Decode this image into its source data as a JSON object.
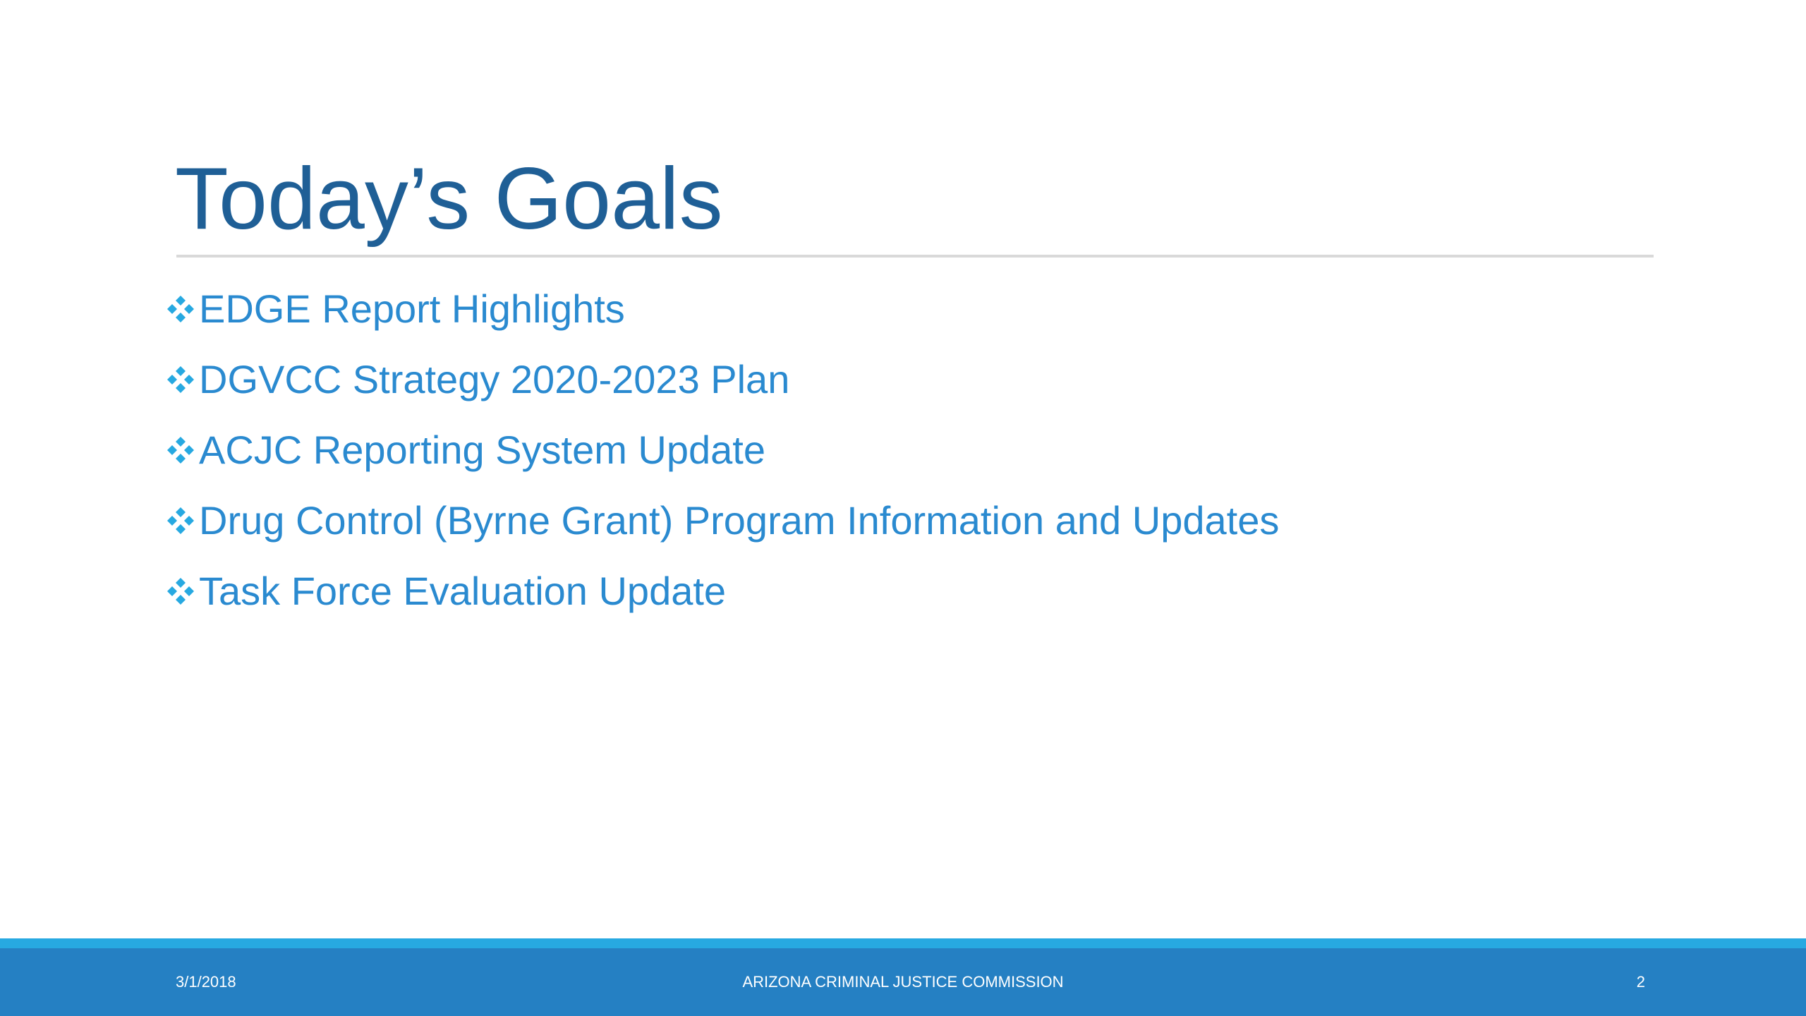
{
  "slide": {
    "title": "Today’s Goals",
    "bullets": [
      "EDGE Report Highlights",
      "DGVCC Strategy 2020-2023 Plan",
      "ACJC Reporting System Update",
      "Drug Control (Byrne Grant) Program Information and Updates",
      "Task Force Evaluation Update"
    ],
    "bullet_icon": "four-diamond-bullet-icon"
  },
  "footer": {
    "date": "3/1/2018",
    "organization": "ARIZONA CRIMINAL JUSTICE COMMISSION",
    "page_number": "2"
  },
  "colors": {
    "title": "#1f5f96",
    "bullet_text": "#2a8ad0",
    "bullet_icon": "#27a9e1",
    "footer_bar": "#2580c3",
    "footer_accent": "#27a9e1",
    "divider": "#d9d9d9"
  }
}
